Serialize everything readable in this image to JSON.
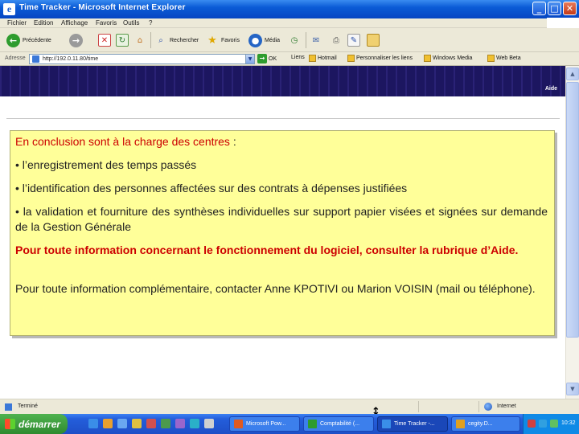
{
  "window": {
    "title": "Time Tracker - Microsoft Internet Explorer",
    "minimize": "_",
    "maximize": "□",
    "close": "✕"
  },
  "menu": [
    "Fichier",
    "Edition",
    "Affichage",
    "Favoris",
    "Outils",
    "?"
  ],
  "toolbar": {
    "back_label": "Précédente",
    "search_label": "Rechercher",
    "favorites_label": "Favoris",
    "media_label": "Média"
  },
  "addressbar": {
    "label": "Adresse",
    "url": "http://192.0.11.80/time",
    "go_label": "OK",
    "links_label": "Liens",
    "links": [
      "Hotmail",
      "Personnaliser les liens",
      "Windows Media",
      "Web Beta"
    ]
  },
  "banner": {
    "help_link": "Aide"
  },
  "slide": {
    "heading_pre": "En conclusion sont à la charge des centres",
    "heading_colon": " :",
    "bullets": [
      "• l’enregistrement des temps passés",
      "• l’identification des personnes affectées sur des contrats à dépenses justifiées",
      "• la validation et fourniture des synthèses individuelles sur support papier visées et signées sur demande de la Gestion Générale"
    ],
    "info_red": "Pour toute information concernant le fonctionnement du logiciel, consulter la rubrique d’Aide.",
    "contact": "Pour toute information complémentaire, contacter Anne KPOTIVI ou Marion VOISIN (mail ou téléphone)."
  },
  "statusbar": {
    "status": "Terminé",
    "zone": "Internet"
  },
  "taskbar": {
    "start_label": "démarrer",
    "tasks": [
      "Microsoft Pow...",
      "Comptabilité (...",
      "Time Tracker -...",
      "cegity.D..."
    ],
    "active_task_index": 2,
    "clock": "10:32"
  },
  "colors": {
    "slide_background": "#ffff99",
    "slide_red": "#cc0000",
    "banner": "#241d6b",
    "taskbar": "#245edb"
  }
}
